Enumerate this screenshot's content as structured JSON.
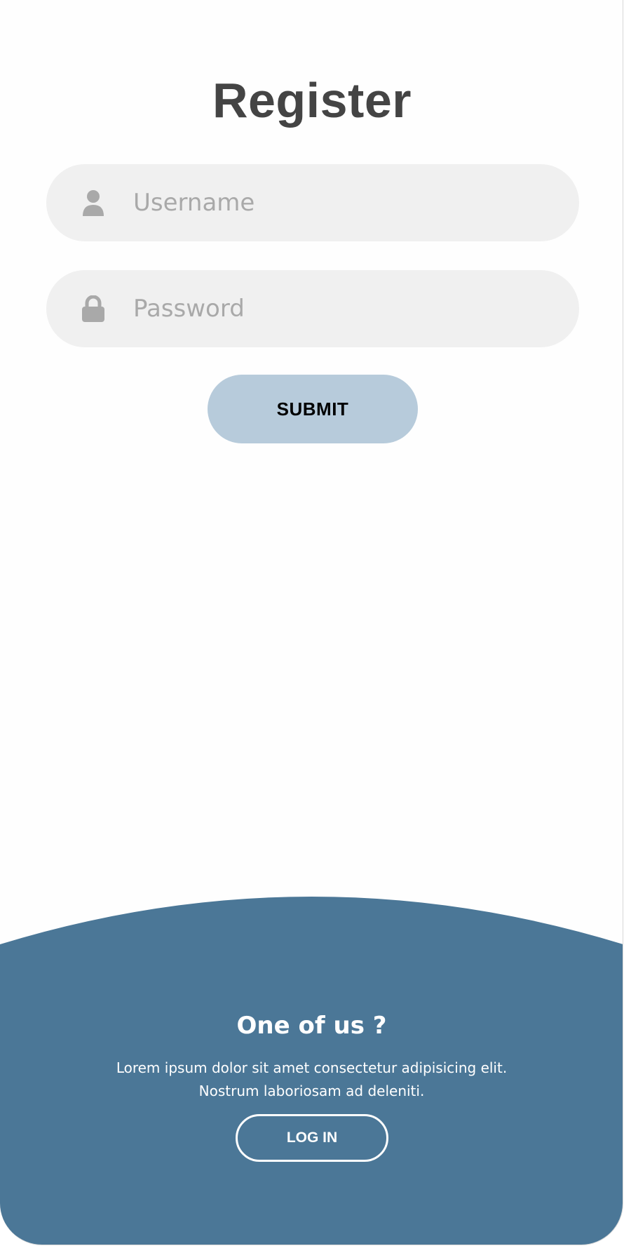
{
  "register": {
    "title": "Register",
    "username": {
      "placeholder": "Username",
      "value": ""
    },
    "password": {
      "placeholder": "Password",
      "value": ""
    },
    "submit_label": "SUBMIT"
  },
  "panel": {
    "title": "One of us ?",
    "text_line_1": "Lorem ipsum dolor sit amet consectetur adipisicing elit.",
    "text_line_2": "Nostrum laboriosam ad deleniti.",
    "login_label": "LOG IN"
  },
  "colors": {
    "panel_bg": "#4b7797",
    "submit_bg": "#b7cbdb",
    "field_bg": "#f0f0f0",
    "icon": "#a9a9a9",
    "title": "#444444"
  },
  "icons": {
    "username": "user-icon",
    "password": "lock-icon"
  }
}
